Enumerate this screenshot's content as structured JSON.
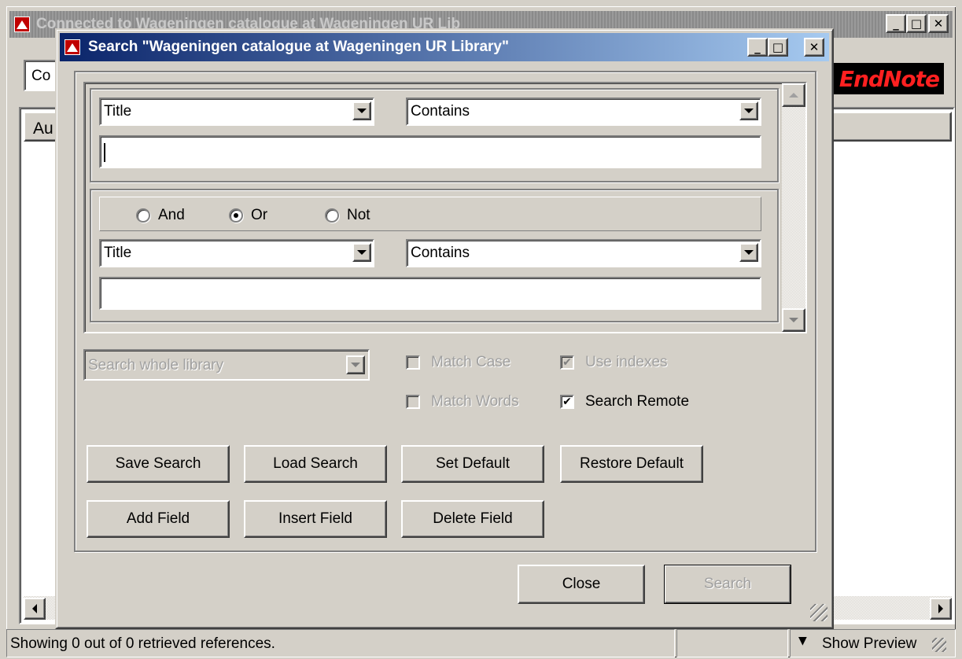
{
  "background_window": {
    "title_fragment": "Connected to Wageningen catalogue at Wageningen UR Lib",
    "toolbar_combo_fragment": "Co",
    "column_header_fragment": "Au",
    "logo_text": "EndNote",
    "status_text": "Showing 0 out of 0 retrieved references.",
    "show_preview_label": "Show Preview",
    "controls": {
      "minimize": "_",
      "maximize": "□",
      "close": "✕"
    }
  },
  "dialog": {
    "title": "Search \"Wageningen catalogue at Wageningen UR Library\"",
    "controls": {
      "minimize": "_",
      "maximize": "□",
      "close": "✕"
    },
    "criteria": [
      {
        "field": "Title",
        "operator": "Contains",
        "value": ""
      },
      {
        "field": "Title",
        "operator": "Contains",
        "value": ""
      }
    ],
    "bool_options": {
      "and": "And",
      "or": "Or",
      "not": "Not",
      "selected": "Or"
    },
    "scope": {
      "value": "Search whole library",
      "enabled": false
    },
    "options": {
      "match_case": {
        "label": "Match Case",
        "checked": false,
        "enabled": false
      },
      "use_indexes": {
        "label": "Use indexes",
        "checked": true,
        "enabled": false
      },
      "match_words": {
        "label": "Match Words",
        "checked": false,
        "enabled": false
      },
      "search_remote": {
        "label": "Search Remote",
        "checked": true,
        "enabled": true
      }
    },
    "buttons": {
      "save_search": "Save Search",
      "load_search": "Load Search",
      "set_default": "Set Default",
      "restore_default": "Restore Default",
      "add_field": "Add Field",
      "insert_field": "Insert Field",
      "delete_field": "Delete Field",
      "close": "Close",
      "search": "Search"
    }
  },
  "colors": {
    "titlebar_active_start": "#0a246a",
    "titlebar_active_end": "#a6caf0",
    "titlebar_inactive": "#808080",
    "face": "#d4d0c8",
    "logo_red": "#ff2020"
  }
}
